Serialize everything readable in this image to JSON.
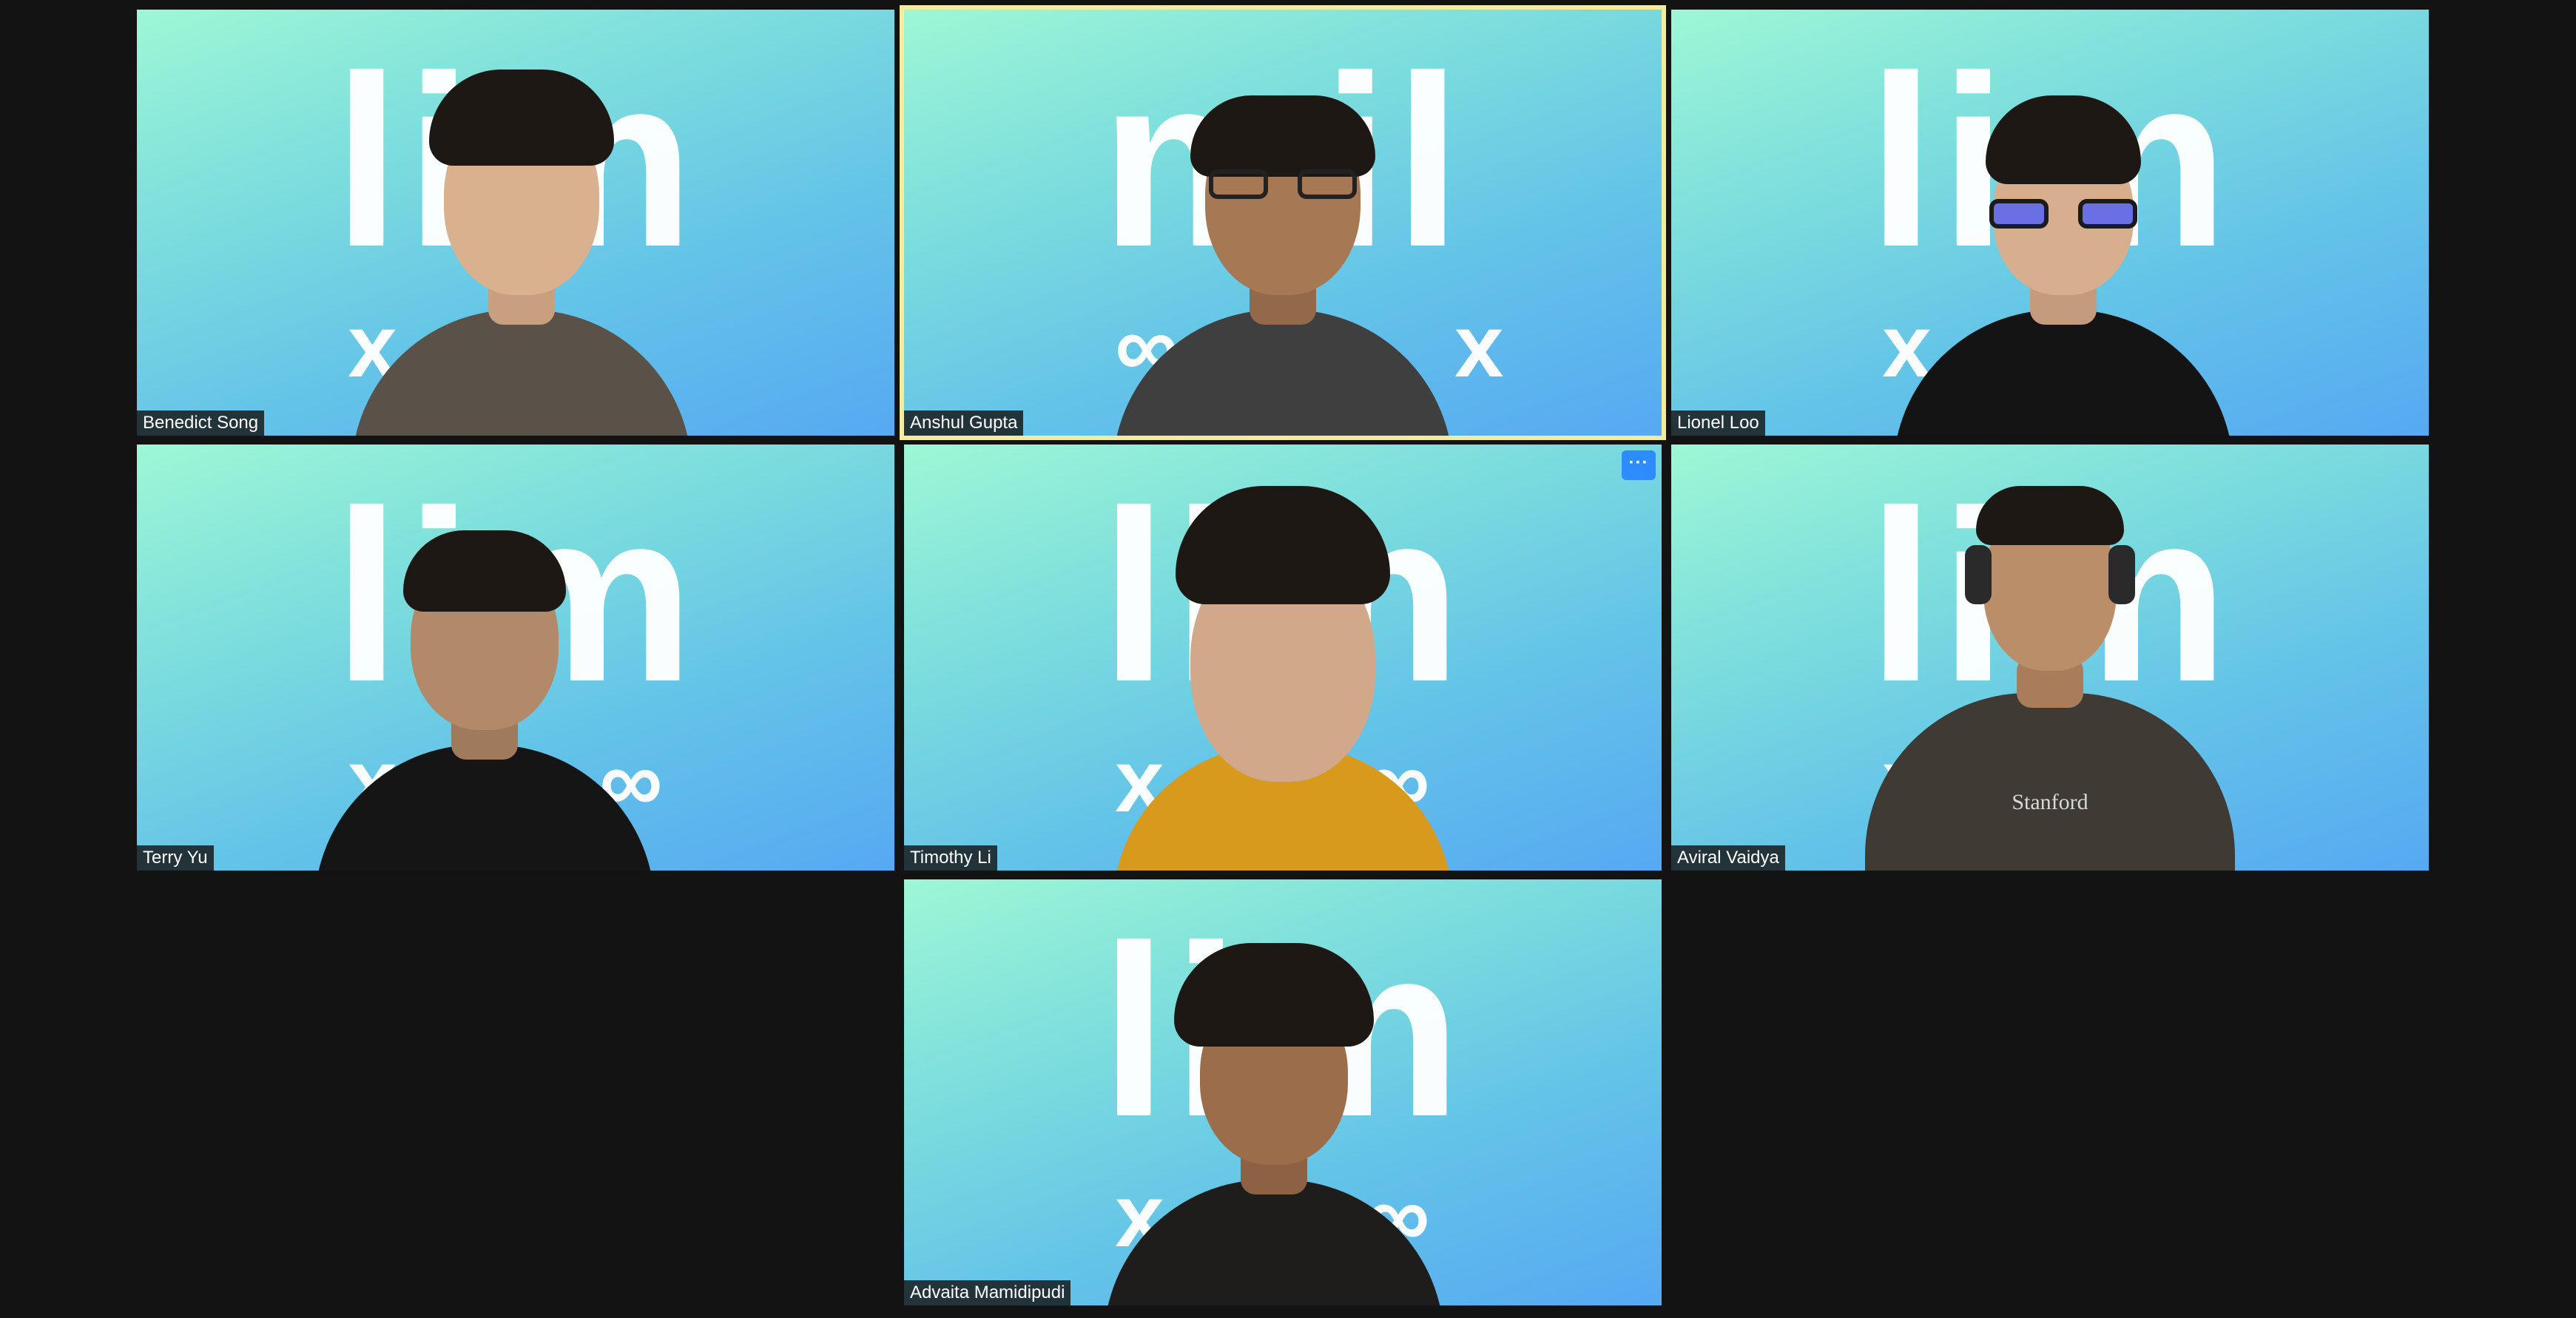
{
  "meeting": {
    "view": "gallery",
    "participants": [
      {
        "name": "Benedict Song",
        "background_word": "lim",
        "background_sub": "x",
        "speaking": false,
        "skin": "#d9b18f",
        "shirt": "#5a5148"
      },
      {
        "name": "Anshul Gupta",
        "background_word": "mil",
        "background_sub": "∞ x",
        "speaking": true,
        "skin": "#a77854",
        "shirt": "#3f3f3f"
      },
      {
        "name": "Lionel Loo",
        "background_word": "lim",
        "background_sub": "x",
        "speaking": false,
        "skin": "#d7ae8e",
        "shirt": "#141414"
      },
      {
        "name": "Terry Yu",
        "background_word": "lim",
        "background_sub": "x ∞",
        "speaking": false,
        "skin": "#b38a69",
        "shirt": "#151515"
      },
      {
        "name": "Timothy Li",
        "background_word": "lim",
        "background_sub": "x ∞",
        "speaking": false,
        "skin": "#d2a88b",
        "shirt": "#d79a1c"
      },
      {
        "name": "Aviral Vaidya",
        "background_word": "lim",
        "background_sub": "x",
        "speaking": false,
        "skin": "#bb8e6a",
        "shirt": "#3f3a34",
        "shirt_text": "Stanford"
      },
      {
        "name": "Advaita Mamidipudi",
        "background_word": "lim",
        "background_sub": "x ∞",
        "speaking": false,
        "skin": "#9c6d4a",
        "shirt": "#1f1d1b"
      }
    ]
  },
  "more_button": {
    "label": "···",
    "icon": "more-options-icon"
  },
  "colors": {
    "background": "#131313",
    "active_speaker_border": "#f3ec9c",
    "accent": "#2d8cff",
    "name_label_bg": "#141414"
  }
}
